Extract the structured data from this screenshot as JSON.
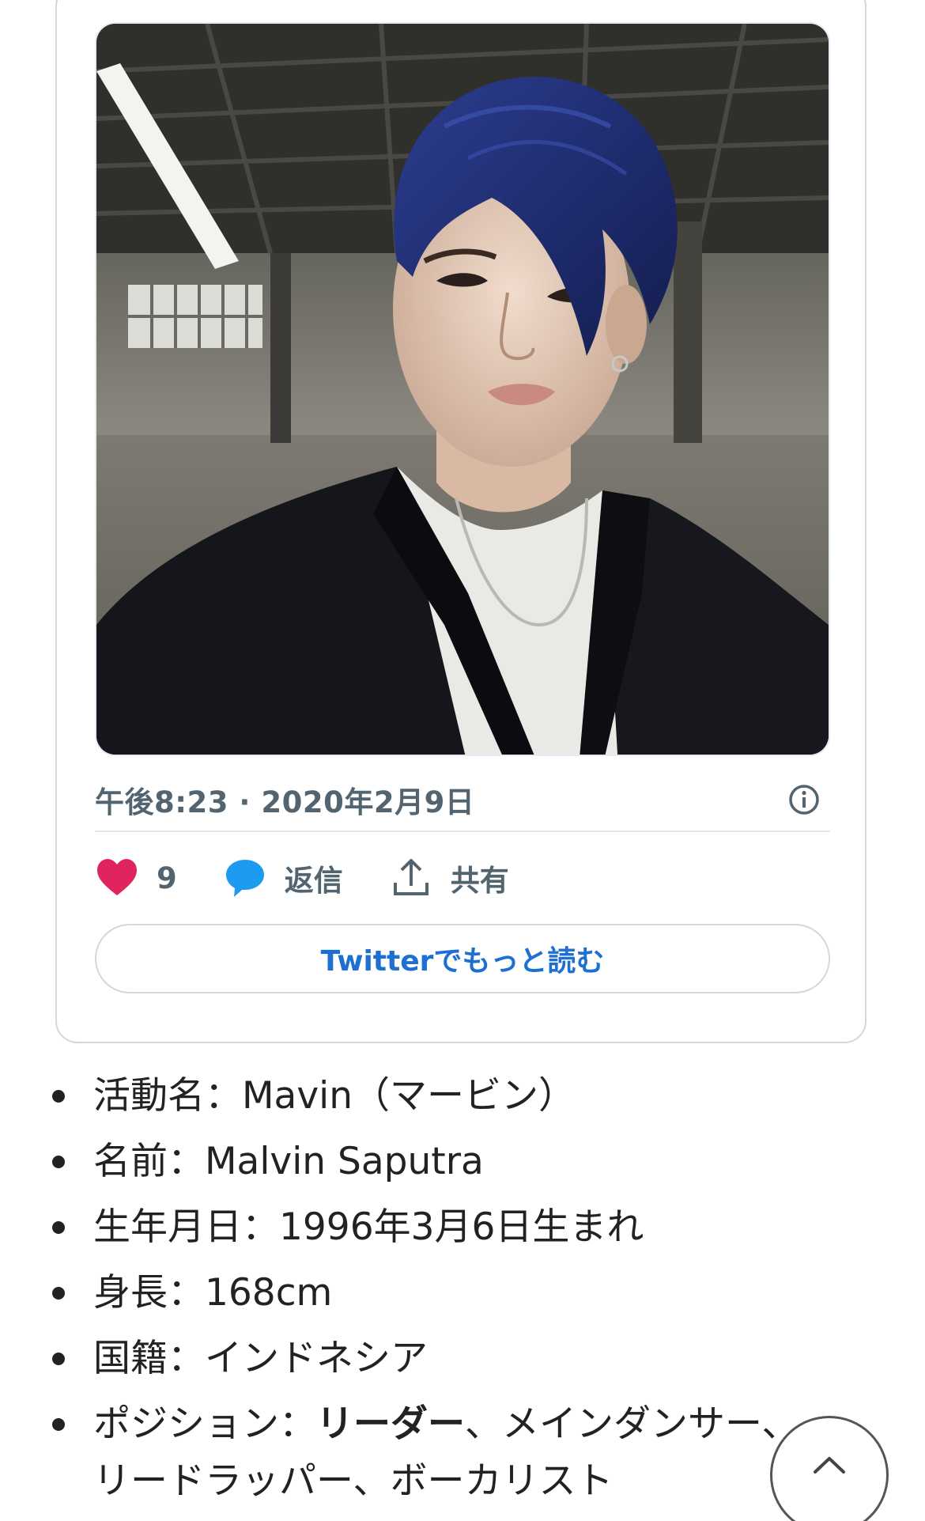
{
  "tweet": {
    "timestamp": "午後8:23 · 2020年2月9日",
    "likes": {
      "count": "9",
      "icon": "heart-icon",
      "color": "#e0245e"
    },
    "reply": {
      "label": "返信",
      "icon": "speech-bubble-icon",
      "color": "#1d9bf0"
    },
    "share": {
      "label": "共有",
      "icon": "share-upload-icon"
    },
    "read_more_label": "Twitterでもっと読む",
    "info_icon": "info-icon",
    "accent_color": "#1d6fd1"
  },
  "profile": {
    "items": [
      {
        "label": "活動名",
        "sep": "：",
        "value": "Mavin（マービン）"
      },
      {
        "label": "名前",
        "sep": "：",
        "value": "Malvin Saputra"
      },
      {
        "label": "生年月日",
        "sep": "：",
        "value": "1996年3月6日生まれ"
      },
      {
        "label": "身長",
        "sep": "：",
        "value": "168cm"
      },
      {
        "label": "国籍",
        "sep": "：",
        "value": "インドネシア"
      },
      {
        "label": "ポジション",
        "sep": "：",
        "value_bold": "リーダー",
        "value_rest": "、メインダンサー、リードラッパー、ボーカリスト"
      }
    ]
  },
  "scroll_top_icon": "chevron-up-icon"
}
